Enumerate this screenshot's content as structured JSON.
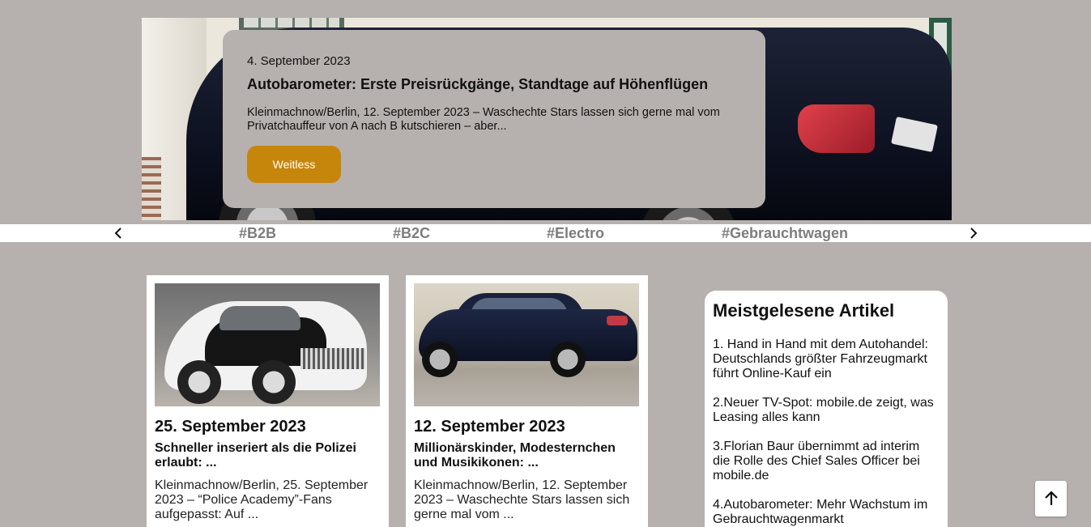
{
  "hero": {
    "date": "4. September 2023",
    "title": "Autobarometer: Erste Preisrückgänge, Standtage auf Höhenflügen",
    "excerpt": "Kleinmachnow/Berlin, 12. September 2023 – Waschechte Stars lassen sich gerne mal vom Privatchauffeur von A nach B kutschieren – aber...",
    "button_label": "Weitless",
    "accent_color": "#c6860b"
  },
  "tags": {
    "items": [
      "#B2B",
      "#B2C",
      "#Electro",
      "#Gebrauchtwagen"
    ],
    "prev_icon": "chevron-left-icon",
    "next_icon": "chevron-right-icon"
  },
  "articles": [
    {
      "date": "25. September 2023",
      "title": "Schneller inseriert als die Polizei erlaubt: ...",
      "excerpt": "Kleinmachnow/Berlin, 25. September 2023 – “Police Academy”-Fans aufgepasst: Auf ..."
    },
    {
      "date": "12. September 2023",
      "title": "Millionärskinder, Modesternchen und Musikikonen: ...",
      "excerpt": "Kleinmachnow/Berlin, 12. September 2023 – Waschechte Stars lassen sich gerne mal vom ..."
    }
  ],
  "sidebar": {
    "heading": "Meistgelesene Artikel",
    "items": [
      "1. Hand in Hand mit dem Autohandel: Deutschlands größter Fahrzeugmarkt führt Online-Kauf ein",
      "2.Neuer TV-Spot: mobile.de zeigt, was Leasing alles kann",
      "3.Florian Baur übernimmt ad interim die Rolle des Chief Sales Officer bei mobile.de",
      "4.Autobarometer: Mehr Wachstum im Gebrauchtwagenmarkt"
    ]
  },
  "back_to_top_icon": "arrow-up-icon"
}
